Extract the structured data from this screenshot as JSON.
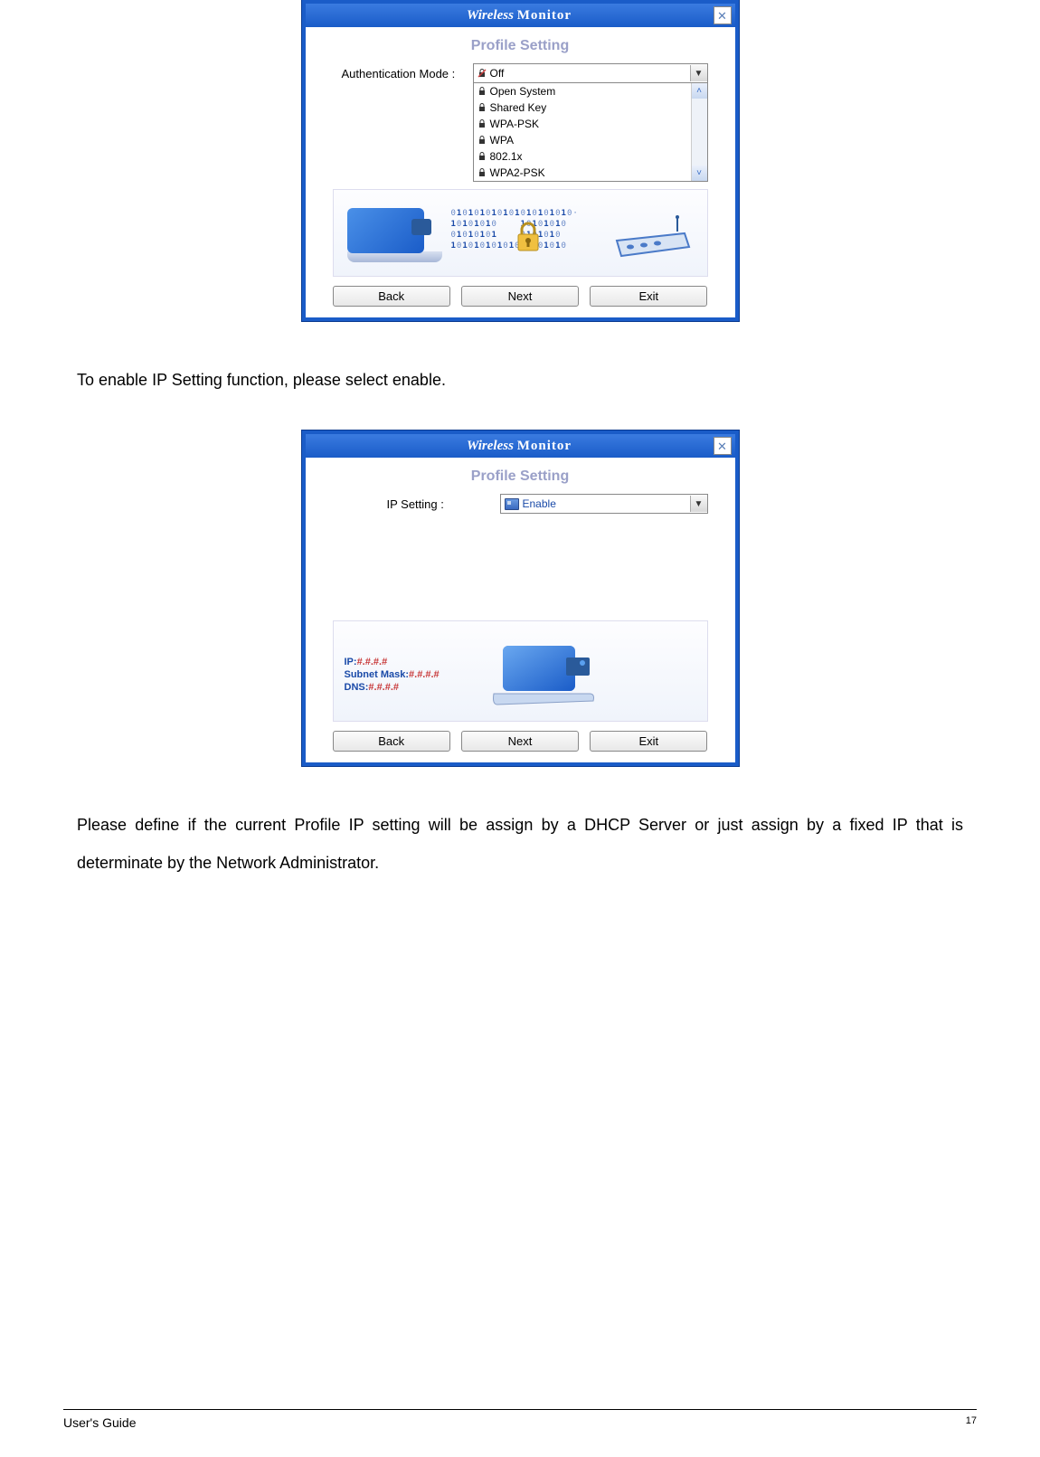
{
  "dialog1": {
    "app_title_wireless": "Wireless",
    "app_title_monitor": "Monitor",
    "section_title": "Profile Setting",
    "label": "Authentication Mode :",
    "selected": "Off",
    "options": [
      "Open System",
      "Shared Key",
      "WPA-PSK",
      "WPA",
      "802.1x",
      "WPA2-PSK"
    ],
    "buttons": {
      "back": "Back",
      "next": "Next",
      "exit": "Exit"
    }
  },
  "para1": "To enable IP Setting function, please select enable.",
  "dialog2": {
    "app_title_wireless": "Wireless",
    "app_title_monitor": "Monitor",
    "section_title": "Profile Setting",
    "label": "IP Setting :",
    "selected": "Enable",
    "ip_line": {
      "k": "IP:",
      "v": "#.#.#.#"
    },
    "mask_line": {
      "k": "Subnet Mask:",
      "v": "#.#.#.#"
    },
    "dns_line": {
      "k": "DNS:",
      "v": "#.#.#.#"
    },
    "buttons": {
      "back": "Back",
      "next": "Next",
      "exit": "Exit"
    }
  },
  "para2": "Please define if the current Profile IP setting will be assign by a DHCP Server or just assign by a fixed IP that is determinate by the Network Administrator.",
  "footer": {
    "left": "User's Guide",
    "page": "17"
  }
}
